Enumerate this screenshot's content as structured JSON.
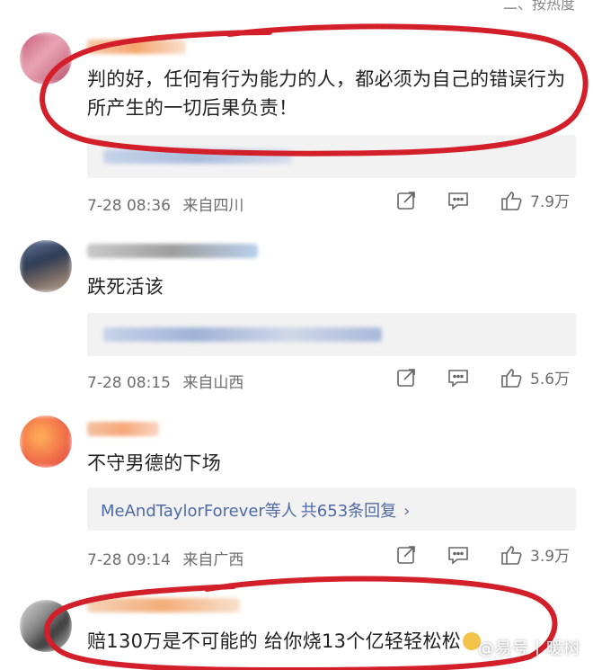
{
  "header": {
    "sort_label": "二、按热度"
  },
  "comments": [
    {
      "text": "判的好，任何有行为能力的人，都必须为自己的错误行为所产生的一切后果负责！",
      "time": "7-28 08:36",
      "location": "来自四川",
      "likes": "7.9万"
    },
    {
      "text": "跌死活该",
      "time": "7-28 08:15",
      "location": "来自山西",
      "likes": "5.6万"
    },
    {
      "text": "不守男德的下场",
      "time": "7-28 09:14",
      "location": "来自广西",
      "likes": "3.9万",
      "reply_preview": {
        "users": "MeAndTaylorForever等人",
        "count": "共653条回复"
      }
    },
    {
      "text": "赔130万是不可能的 给你烧13个亿轻轻松松"
    }
  ],
  "watermark": "@易号丨暖树",
  "colors": {
    "circle": "#d31f2a",
    "link": "#4f6aa6"
  },
  "icons": [
    "share-icon",
    "comment-icon",
    "like-icon",
    "chevron-right-icon"
  ]
}
